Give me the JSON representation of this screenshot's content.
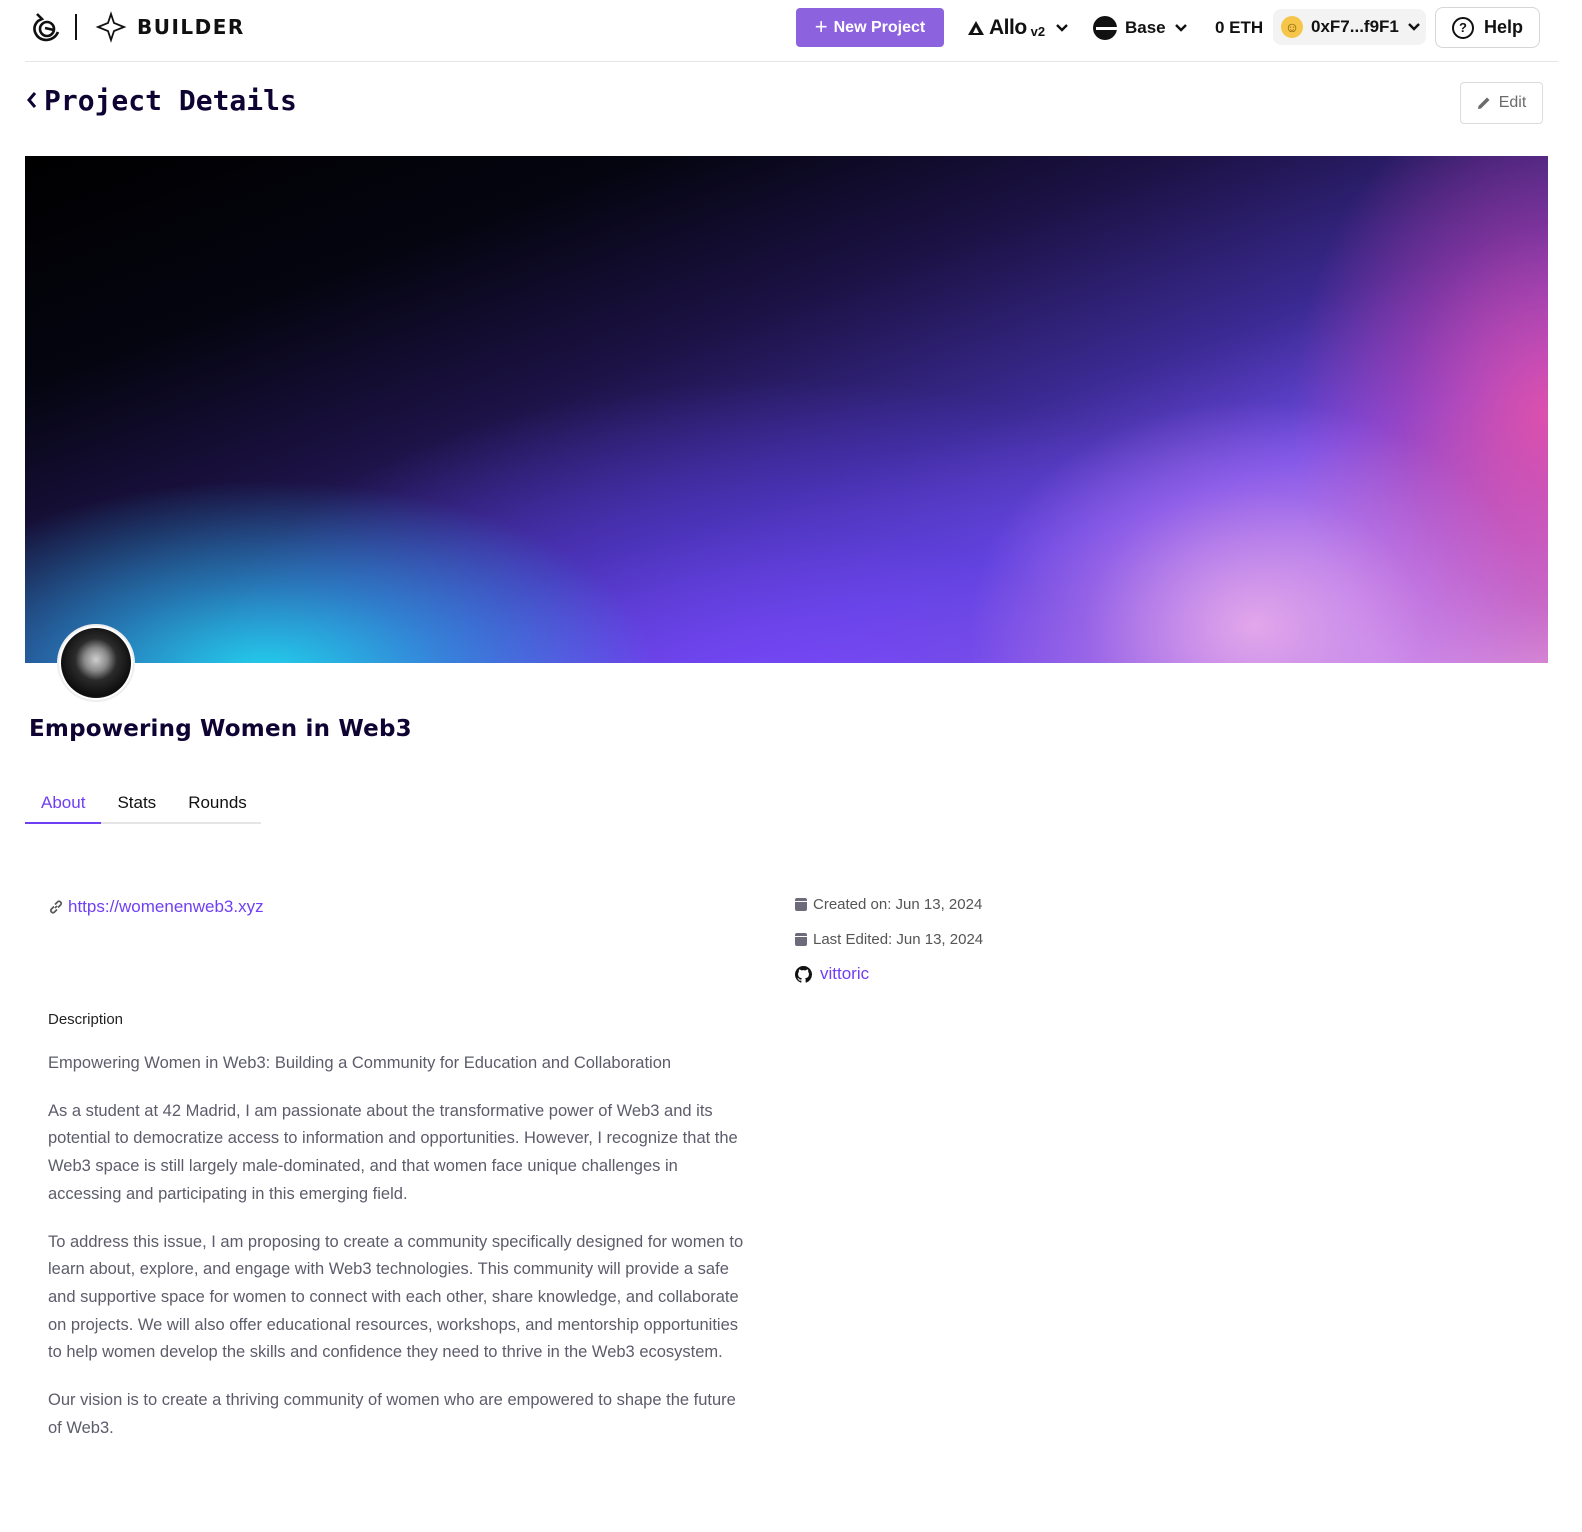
{
  "header": {
    "brand": "BUILDER",
    "new_project_label": "New Project",
    "protocol_name": "Allo",
    "protocol_version": "v2",
    "network": "Base",
    "balance": "0 ETH",
    "wallet_address": "0xF7...f9F1",
    "help_label": "Help"
  },
  "page": {
    "title": "Project Details",
    "edit_label": "Edit"
  },
  "project": {
    "name": "Empowering Women in Web3",
    "website": "https://womenenweb3.xyz",
    "created_on": "Created on: Jun 13, 2024",
    "last_edited": "Last Edited: Jun 13, 2024",
    "github_user": "vittoric"
  },
  "tabs": [
    {
      "label": "About",
      "active": true
    },
    {
      "label": "Stats",
      "active": false
    },
    {
      "label": "Rounds",
      "active": false
    }
  ],
  "description": {
    "label": "Description",
    "paragraphs": [
      "Empowering Women in Web3: Building a Community for Education and Collaboration",
      "As a student at 42 Madrid, I am passionate about the transformative power of Web3 and its potential to democratize access to information and opportunities. However, I recognize that the Web3 space is still largely male-dominated, and that women face unique challenges in accessing and participating in this emerging field.",
      "To address this issue, I am proposing to create a community specifically designed for women to learn about, explore, and engage with Web3 technologies. This community will provide a safe and supportive space for women to connect with each other, share knowledge, and collaborate on projects. We will also offer educational resources, workshops, and mentorship opportunities to help women develop the skills and confidence they need to thrive in the Web3 ecosystem.",
      "Our vision is to create a thriving community of women who are empowered to shape the future of Web3."
    ]
  },
  "colors": {
    "accent": "#6f3ff5",
    "new_project_bg": "#8c62df"
  },
  "icons": [
    "gitcoin-logo-icon",
    "builder-icon",
    "plus-icon",
    "allo-icon",
    "chevron-down-icon",
    "base-network-icon",
    "wallet-avatar-icon",
    "help-icon",
    "back-chevron-icon",
    "pencil-icon",
    "link-icon",
    "calendar-icon",
    "github-icon"
  ]
}
